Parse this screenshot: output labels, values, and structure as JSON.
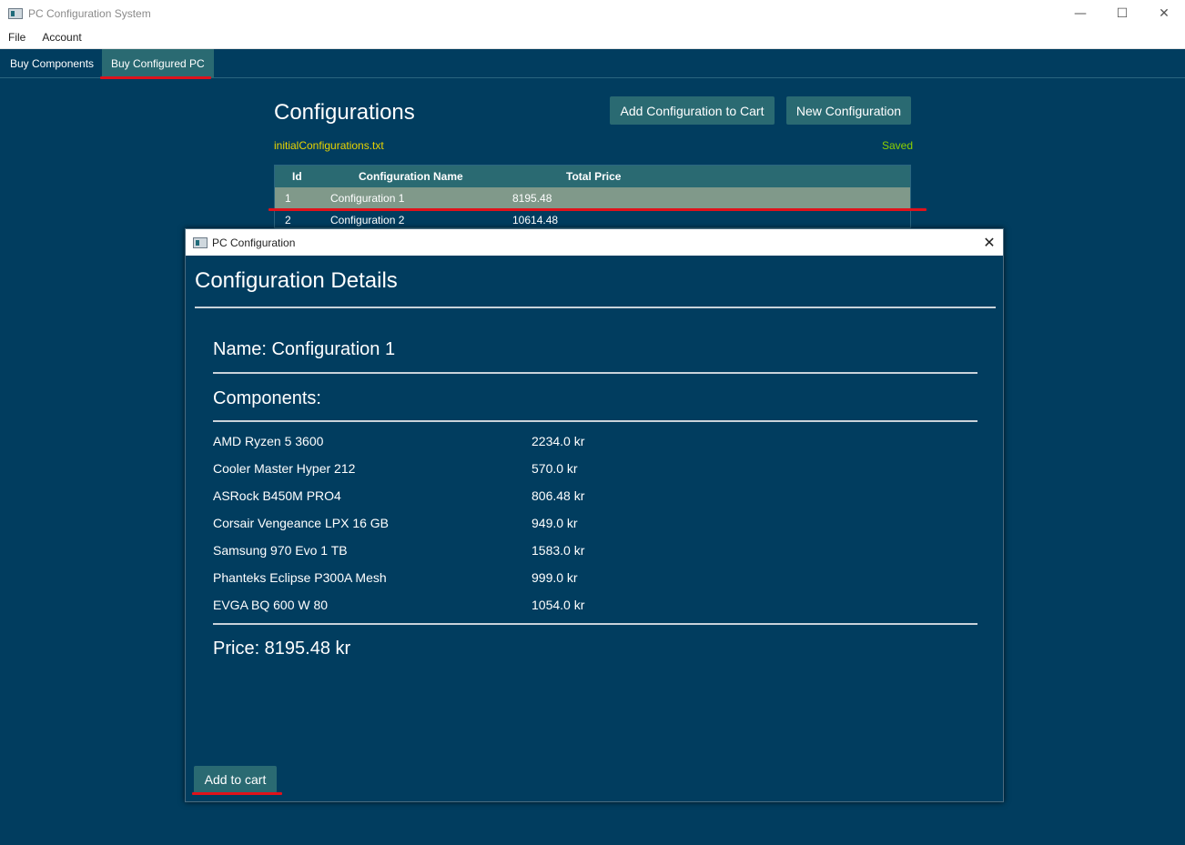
{
  "window": {
    "title": "PC Configuration System"
  },
  "window_controls": {
    "minimize": "—",
    "maximize": "☐",
    "close": "✕"
  },
  "menu": {
    "file": "File",
    "account": "Account"
  },
  "tabs": [
    {
      "label": "Buy Components"
    },
    {
      "label": "Buy Configured PC",
      "selected": true
    }
  ],
  "main": {
    "title": "Configurations",
    "add_to_cart_button": "Add Configuration to Cart",
    "new_config_button": "New Configuration",
    "filename": "initialConfigurations.txt",
    "status": "Saved",
    "table": {
      "headers": [
        "Id",
        "Configuration Name",
        "Total Price"
      ],
      "rows": [
        {
          "id": "1",
          "name": "Configuration 1",
          "price": "8195.48",
          "selected": true
        },
        {
          "id": "2",
          "name": "Configuration 2",
          "price": "10614.48"
        }
      ]
    }
  },
  "dialog": {
    "title": "PC Configuration",
    "close": "✕",
    "heading": "Configuration Details",
    "name_line": "Name: Configuration 1",
    "components_label": "Components:",
    "components": [
      {
        "name": "AMD Ryzen 5 3600",
        "price": "2234.0 kr"
      },
      {
        "name": "Cooler Master Hyper 212",
        "price": "570.0 kr"
      },
      {
        "name": "ASRock B450M PRO4",
        "price": "806.48 kr"
      },
      {
        "name": "Corsair Vengeance LPX 16 GB",
        "price": "949.0 kr"
      },
      {
        "name": "Samsung 970 Evo 1 TB",
        "price": "1583.0 kr"
      },
      {
        "name": "Phanteks Eclipse P300A Mesh",
        "price": "999.0 kr"
      },
      {
        "name": "EVGA BQ 600 W 80",
        "price": "1054.0 kr"
      }
    ],
    "price_line": "Price: 8195.48 kr",
    "add_to_cart_button": "Add to cart"
  },
  "colors": {
    "background": "#013d5f",
    "button": "#2a6a72",
    "selected_row": "#80998a",
    "annotation": "#e0121b",
    "filename": "#e9d400",
    "saved": "#8cd000"
  }
}
